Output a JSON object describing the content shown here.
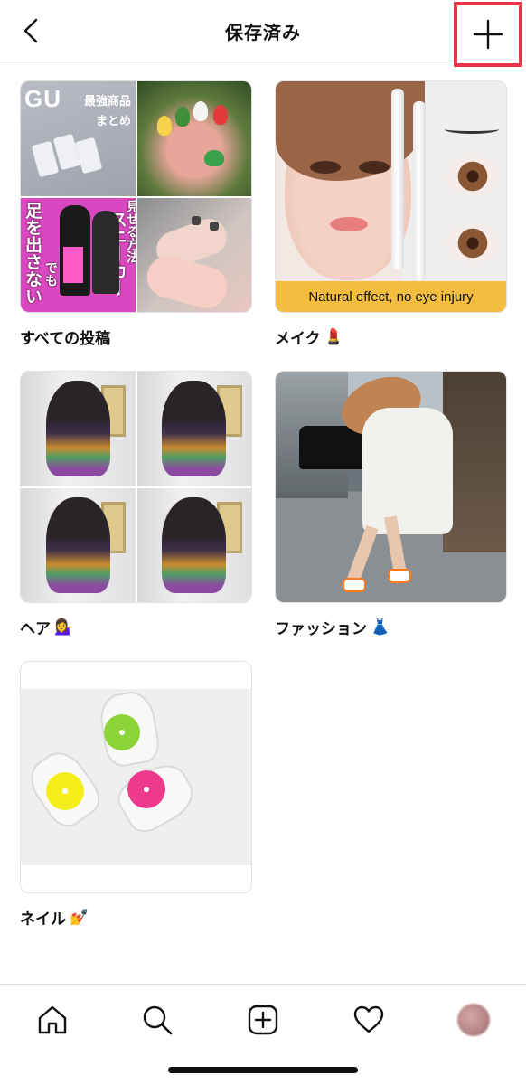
{
  "header": {
    "title": "保存済み",
    "back_icon": "chevron-left-icon",
    "add_icon": "plus-icon",
    "highlight_color": "#e8334a"
  },
  "collections": [
    {
      "label": "すべての投稿",
      "emoji": "",
      "thumb": {
        "gu_logo": "GU",
        "gu_caption_line1": "最強商品",
        "gu_caption_line2": "まとめ",
        "pink_caption_a": "足を出さない",
        "pink_caption_b": "でも",
        "pink_caption_c": "スニーカー",
        "pink_caption_d": "見せる方法"
      }
    },
    {
      "label": "メイク",
      "emoji": "💄",
      "thumb": {
        "banner": "Natural effect, no eye injury"
      }
    },
    {
      "label": "ヘア",
      "emoji": "💁‍♀️",
      "thumb": {}
    },
    {
      "label": "ファッション",
      "emoji": "👗",
      "thumb": {}
    },
    {
      "label": "ネイル",
      "emoji": "💅",
      "thumb": {}
    }
  ],
  "bottom_nav": {
    "items": [
      "home-icon",
      "search-icon",
      "add-post-icon",
      "heart-icon",
      "profile-avatar"
    ]
  }
}
